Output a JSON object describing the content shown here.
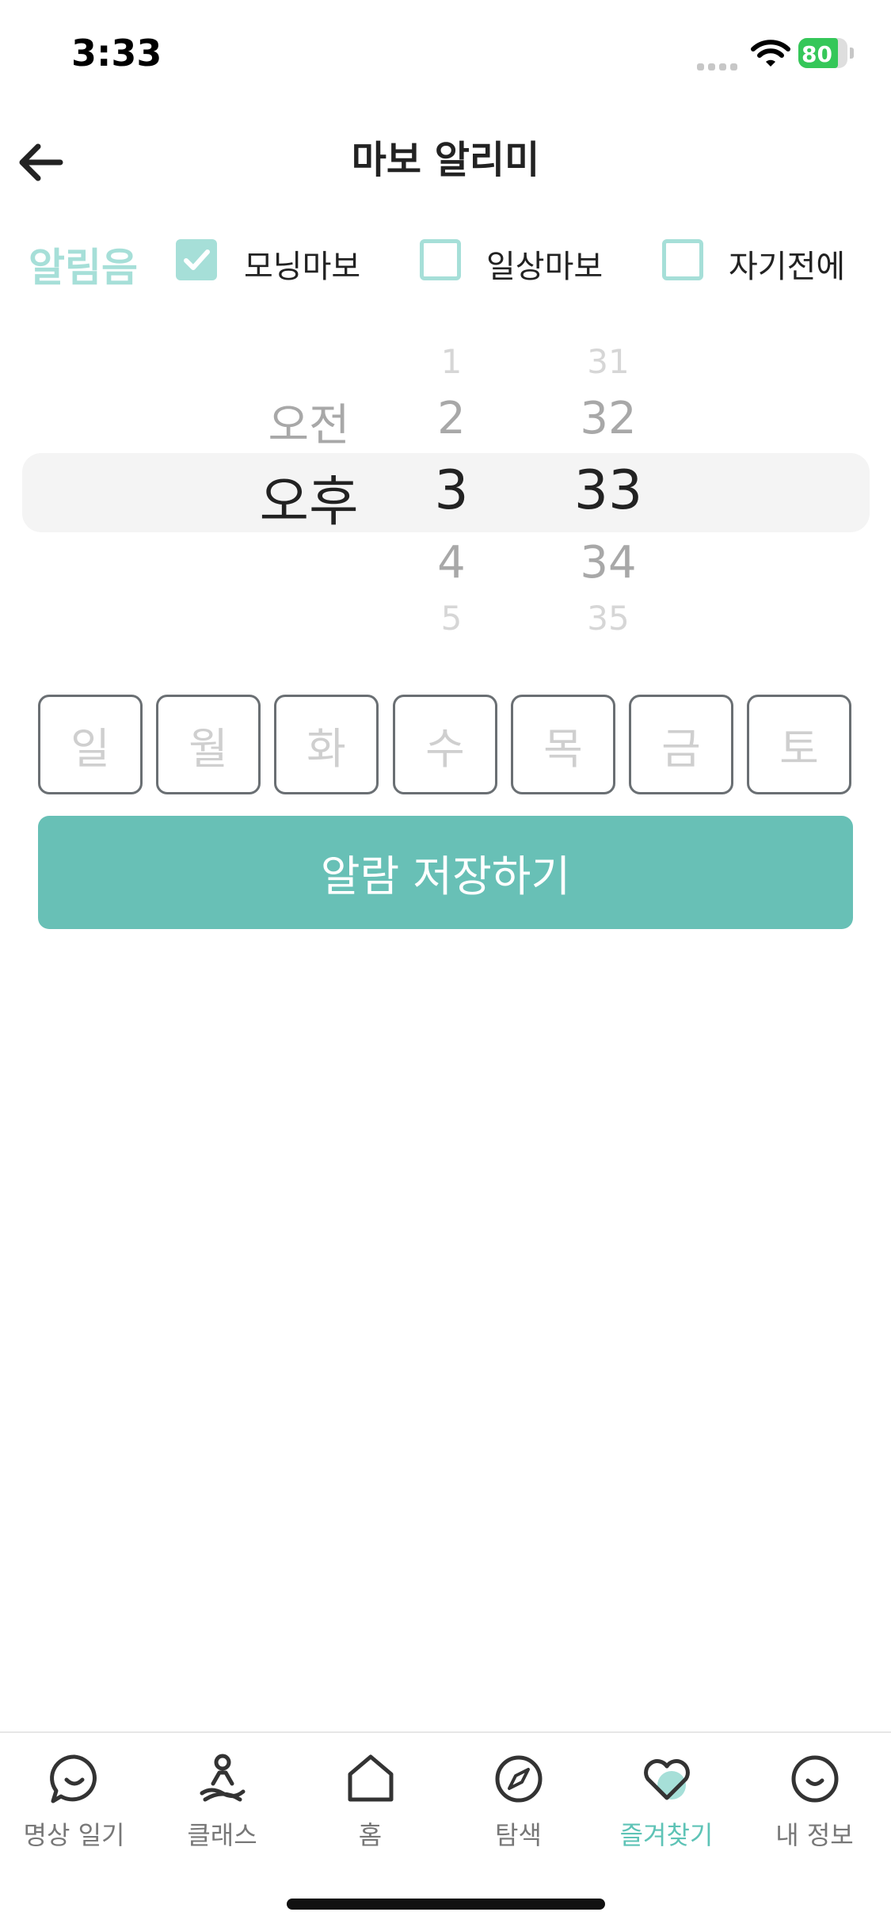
{
  "status_bar": {
    "time": "3:33",
    "battery": "80"
  },
  "header": {
    "title": "마보 알리미",
    "back_icon": "arrow-left-icon"
  },
  "sound": {
    "label": "알림음",
    "options": [
      {
        "label": "모닝마보",
        "checked": true
      },
      {
        "label": "일상마보",
        "checked": false
      },
      {
        "label": "자기전에",
        "checked": false
      }
    ]
  },
  "picker": {
    "period": {
      "above": "오전",
      "selected": "오후"
    },
    "hour": {
      "above2": "1",
      "above1": "2",
      "selected": "3",
      "below1": "4",
      "below2": "5"
    },
    "minute": {
      "above2": "31",
      "above1": "32",
      "selected": "33",
      "below1": "34",
      "below2": "35"
    }
  },
  "days": [
    "일",
    "월",
    "화",
    "수",
    "목",
    "금",
    "토"
  ],
  "save_button": "알람 저장하기",
  "tabs": [
    {
      "label": "명상 일기",
      "icon": "chat-smile-icon",
      "active": false
    },
    {
      "label": "클래스",
      "icon": "meditation-person-icon",
      "active": false
    },
    {
      "label": "홈",
      "icon": "home-icon",
      "active": false
    },
    {
      "label": "탐색",
      "icon": "compass-icon",
      "active": false
    },
    {
      "label": "즐겨찾기",
      "icon": "heart-icon",
      "active": true
    },
    {
      "label": "내 정보",
      "icon": "smile-face-icon",
      "active": false
    }
  ],
  "colors": {
    "accent": "#68c0b6",
    "accent_light": "#a6dfd8",
    "active_tab": "#5ec3b6"
  }
}
